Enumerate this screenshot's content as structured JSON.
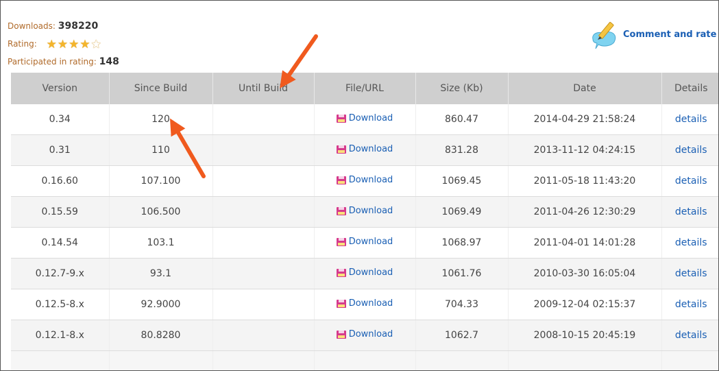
{
  "stats": {
    "downloads_label": "Downloads:",
    "downloads_value": "398220",
    "rating_label": "Rating:",
    "rating_stars": 4.5,
    "participated_label": "Participated in rating:",
    "participated_value": "148"
  },
  "comment": {
    "label": "Comment and rate",
    "icon": "pencil-comment-icon"
  },
  "table": {
    "headers": [
      "Version",
      "Since Build",
      "Until Build",
      "File/URL",
      "Size (Kb)",
      "Date",
      "Details"
    ],
    "rows": [
      {
        "version": "0.34",
        "since": "120",
        "until": "",
        "file": "Download",
        "size": "860.47",
        "date": "2014-04-29 21:58:24",
        "details": "details"
      },
      {
        "version": "0.31",
        "since": "110",
        "until": "",
        "file": "Download",
        "size": "831.28",
        "date": "2013-11-12 04:24:15",
        "details": "details"
      },
      {
        "version": "0.16.60",
        "since": "107.100",
        "until": "",
        "file": "Download",
        "size": "1069.45",
        "date": "2011-05-18 11:43:20",
        "details": "details"
      },
      {
        "version": "0.15.59",
        "since": "106.500",
        "until": "",
        "file": "Download",
        "size": "1069.49",
        "date": "2011-04-26 12:30:29",
        "details": "details"
      },
      {
        "version": "0.14.54",
        "since": "103.1",
        "until": "",
        "file": "Download",
        "size": "1068.97",
        "date": "2011-04-01 14:01:28",
        "details": "details"
      },
      {
        "version": "0.12.7-9.x",
        "since": "93.1",
        "until": "",
        "file": "Download",
        "size": "1061.76",
        "date": "2010-03-30 16:05:04",
        "details": "details"
      },
      {
        "version": "0.12.5-8.x",
        "since": "92.9000",
        "until": "",
        "file": "Download",
        "size": "704.33",
        "date": "2009-12-04 02:15:37",
        "details": "details"
      },
      {
        "version": "0.12.1-8.x",
        "since": "80.8280",
        "until": "",
        "file": "Download",
        "size": "1062.7",
        "date": "2008-10-15 20:45:19",
        "details": "details"
      }
    ]
  },
  "colors": {
    "stats_label": "#b06a2a",
    "link": "#1a5fb4",
    "star": "#f4b52b",
    "header_bg": "#cfcfcf",
    "annotation_arrow": "#f05a1e"
  }
}
